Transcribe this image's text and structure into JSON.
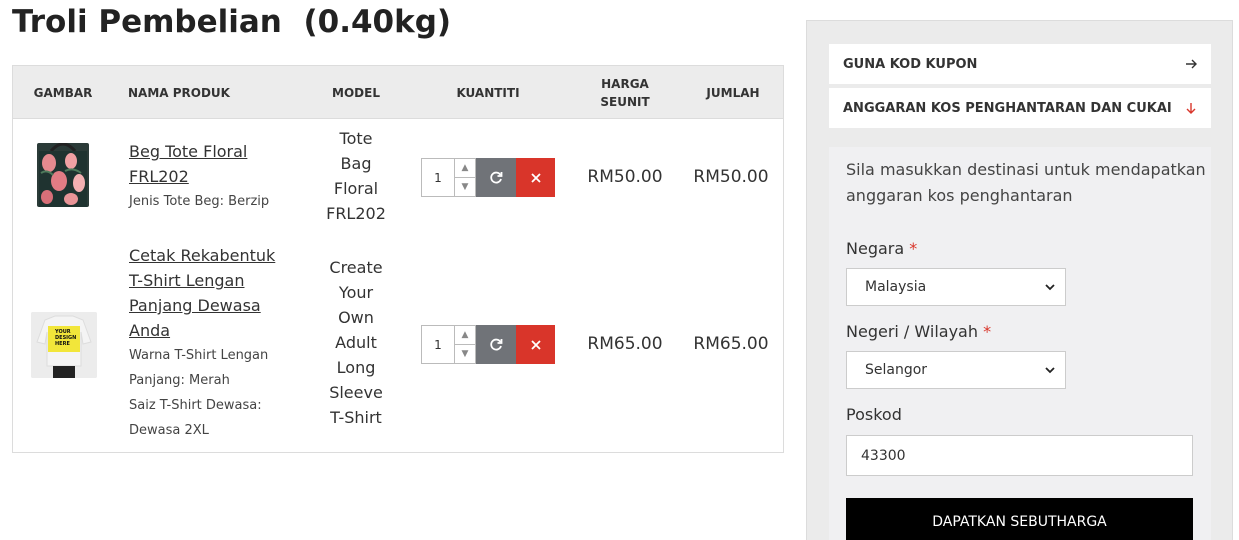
{
  "page": {
    "title": "Troli Pembelian  (0.40kg)"
  },
  "table": {
    "headers": {
      "image": "GAMBAR",
      "name": "NAMA PRODUK",
      "model": "MODEL",
      "quantity": "KUANTITI",
      "unit_price_line1": "HARGA",
      "unit_price_line2": "SEUNIT",
      "total": "JUMLAH"
    },
    "rows": [
      {
        "name_line1": "Beg Tote Floral",
        "name_line2": "FRL202",
        "option1": "Jenis Tote Beg: Berzip",
        "model_lines": [
          "Tote",
          "Bag",
          "Floral",
          "FRL202"
        ],
        "quantity": "1",
        "unit_price": "RM50.00",
        "total": "RM50.00"
      },
      {
        "name_lines": [
          "Cetak Rekabentuk",
          "T-Shirt Lengan",
          "Panjang Dewasa",
          "Anda"
        ],
        "option_lines": [
          "Warna T-Shirt Lengan",
          "Panjang: Merah",
          "Saiz T-Shirt Dewasa:",
          "Dewasa 2XL"
        ],
        "model_lines": [
          "Create",
          "Your",
          "Own",
          "Adult",
          "Long",
          "Sleeve",
          "T-Shirt"
        ],
        "quantity": "1",
        "unit_price": "RM65.00",
        "total": "RM65.00",
        "thumb_text": [
          "YOUR",
          "DESIGN",
          "HERE"
        ]
      }
    ]
  },
  "sidebar": {
    "coupon_label": "GUNA KOD KUPON",
    "shipping_label": "ANGGARAN KOS PENGHANTARAN DAN CUKAI",
    "help_text": "Sila masukkan destinasi untuk mendapatkan anggaran kos penghantaran",
    "country_label": "Negara",
    "country_value": "Malaysia",
    "region_label": "Negeri / Wilayah",
    "region_value": "Selangor",
    "postcode_label": "Poskod",
    "postcode_value": "43300",
    "required_mark": "*",
    "quote_button": "DAPATKAN SEBUTHARGA"
  },
  "colors": {
    "remove_button": "#d9352a",
    "refresh_button": "#707378",
    "quote_button": "#000000"
  }
}
